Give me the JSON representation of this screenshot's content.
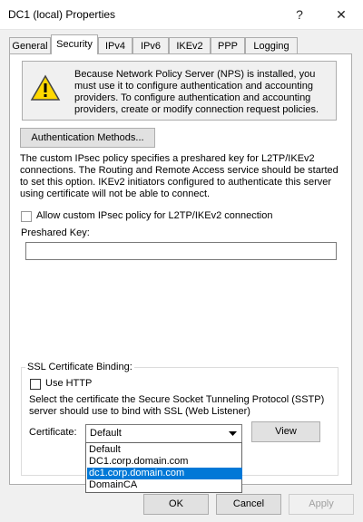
{
  "window": {
    "title": "DC1 (local) Properties",
    "help_glyph": "?",
    "close_glyph": "✕"
  },
  "tabs": [
    {
      "label": "General",
      "selected": false
    },
    {
      "label": "Security",
      "selected": true
    },
    {
      "label": "IPv4",
      "selected": false
    },
    {
      "label": "IPv6",
      "selected": false
    },
    {
      "label": "IKEv2",
      "selected": false
    },
    {
      "label": "PPP",
      "selected": false
    },
    {
      "label": "Logging",
      "selected": false
    }
  ],
  "notice": {
    "icon": "warning-icon",
    "text": "Because Network Policy Server (NPS) is installed, you must use it to configure authentication and accounting providers. To configure authentication and accounting providers, create or modify connection request policies."
  },
  "auth_button": {
    "label": "Authentication Methods..."
  },
  "ipsec": {
    "description": "The custom IPsec policy specifies a preshared key for L2TP/IKEv2 connections. The Routing and Remote Access service should be started to set this option. IKEv2 initiators configured to authenticate this server using certificate will not be able to connect.",
    "checkbox_label": "Allow custom IPsec policy for L2TP/IKEv2 connection",
    "checked": false,
    "preshared_label": "Preshared Key:",
    "preshared_value": ""
  },
  "ssl": {
    "group_label": "SSL Certificate Binding:",
    "use_http_label": "Use HTTP",
    "use_http_checked": false,
    "description": "Select the certificate the Secure Socket Tunneling Protocol (SSTP) server should use to bind with SSL (Web Listener)",
    "certificate_label": "Certificate:",
    "certificate_selected": "Default",
    "certificate_options": [
      "Default",
      "DC1.corp.domain.com",
      "dc1.corp.domain.com",
      "DomainCA"
    ],
    "highlighted_option": "dc1.corp.domain.com",
    "view_label": "View"
  },
  "footer": {
    "ok_label": "OK",
    "cancel_label": "Cancel",
    "apply_label": "Apply"
  },
  "colors": {
    "selection": "#0078d7",
    "warning_yellow": "#ffd800",
    "disabled_text": "#a0a0a0"
  }
}
